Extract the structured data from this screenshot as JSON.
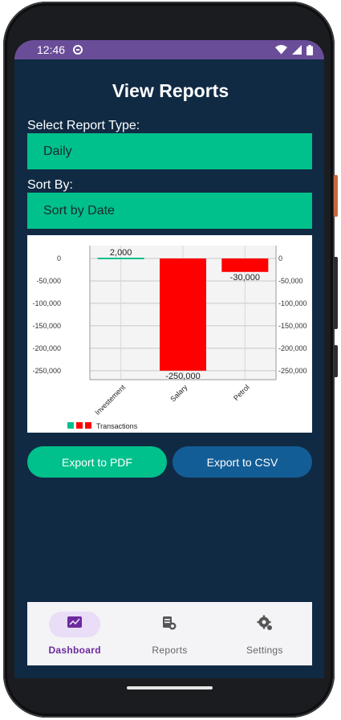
{
  "status_bar": {
    "time": "12:46"
  },
  "page": {
    "title": "View Reports"
  },
  "report_type": {
    "label": "Select Report Type:",
    "value": "Daily"
  },
  "sort": {
    "label": "Sort By:",
    "value": "Sort by Date"
  },
  "chart_data": {
    "type": "bar",
    "categories": [
      "Investement",
      "Salary",
      "Petrol"
    ],
    "values": [
      2000,
      -250000,
      -30000
    ],
    "data_labels": [
      "2,000",
      "-250,000",
      "-30,000"
    ],
    "series": [
      {
        "name": "Transactions",
        "values": [
          2000,
          -250000,
          -30000
        ]
      }
    ],
    "colors": [
      "#00c08b",
      "#ff0000",
      "#ff0000"
    ],
    "ylim": [
      -270000,
      0
    ],
    "yticks": [
      0,
      -50000,
      -100000,
      -150000,
      -200000,
      -250000
    ],
    "ytick_labels": [
      "0",
      "-50,000",
      "-100,000",
      "-150,000",
      "-200,000",
      "-250,000"
    ],
    "dual_y_axis": true,
    "grid": true,
    "legend": "bottom-left",
    "title": "",
    "xlabel": "",
    "ylabel": ""
  },
  "actions": {
    "export_pdf": "Export to PDF",
    "export_csv": "Export to CSV"
  },
  "nav": {
    "items": [
      {
        "label": "Dashboard",
        "icon": "dashboard-icon",
        "active": true
      },
      {
        "label": "Reports",
        "icon": "reports-icon",
        "active": false
      },
      {
        "label": "Settings",
        "icon": "settings-icon",
        "active": false
      }
    ]
  },
  "colors": {
    "background": "#102a43",
    "status_bar": "#6a4d99",
    "accent_green": "#00c08b",
    "accent_blue": "#135d96",
    "negative_red": "#ff0000",
    "nav_active": "#6c2a9e"
  }
}
